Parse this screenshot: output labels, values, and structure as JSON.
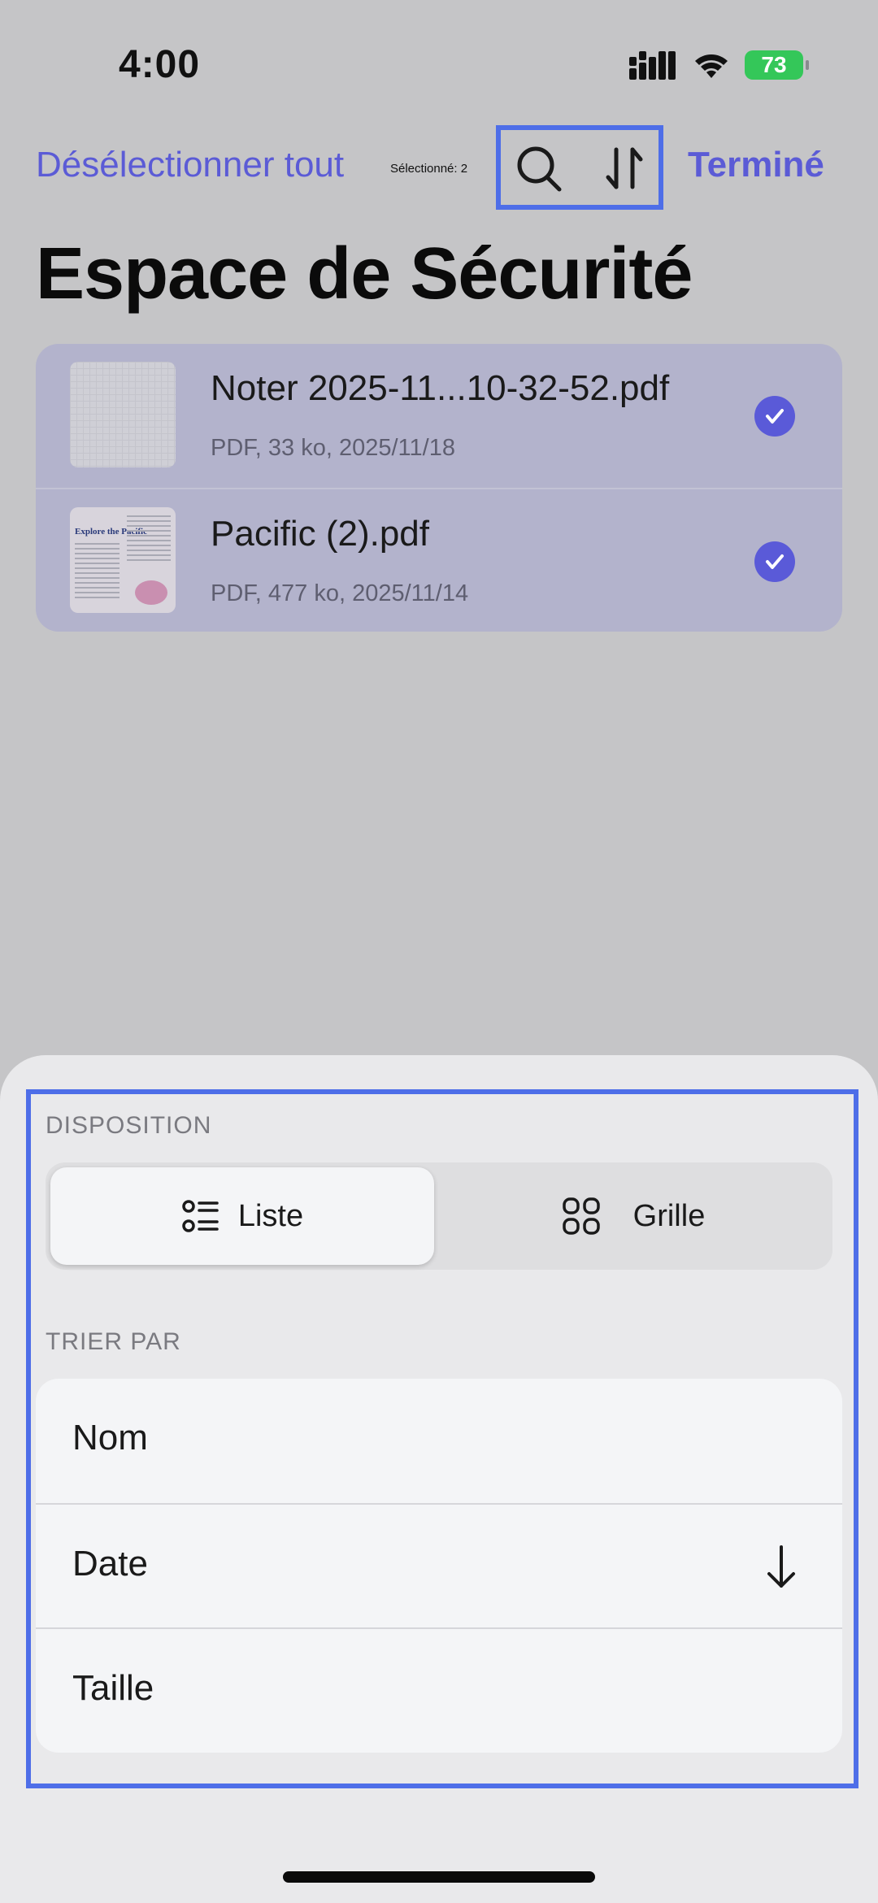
{
  "status_bar": {
    "time": "4:00",
    "battery": "73"
  },
  "nav": {
    "deselect_all": "Désélectionner tout",
    "selected_count": "Sélectionné: 2",
    "done": "Terminé"
  },
  "page": {
    "title": "Espace de Sécurité"
  },
  "files": [
    {
      "name": "Noter 2025-11...10-32-52.pdf",
      "meta": "PDF, 33 ko, 2025/11/18",
      "selected": true
    },
    {
      "name": "Pacific (2).pdf",
      "meta": "PDF, 477 ko, 2025/11/14",
      "selected": true,
      "thumbnail_heading": "Explore the Pacific"
    }
  ],
  "sheet": {
    "layout_label": "DISPOSITION",
    "layout_options": [
      {
        "label": "Liste",
        "icon": "list-icon",
        "selected": true
      },
      {
        "label": "Grille",
        "icon": "grid-icon",
        "selected": false
      }
    ],
    "sort_label": "TRIER PAR",
    "sort_options": [
      {
        "label": "Nom"
      },
      {
        "label": "Date",
        "direction": "descending",
        "icon": "arrow-down-icon"
      },
      {
        "label": "Taille"
      }
    ]
  },
  "colors": {
    "accent": "#5b5bd6",
    "highlight_outline": "#4e6ee8",
    "battery": "#34c759"
  }
}
